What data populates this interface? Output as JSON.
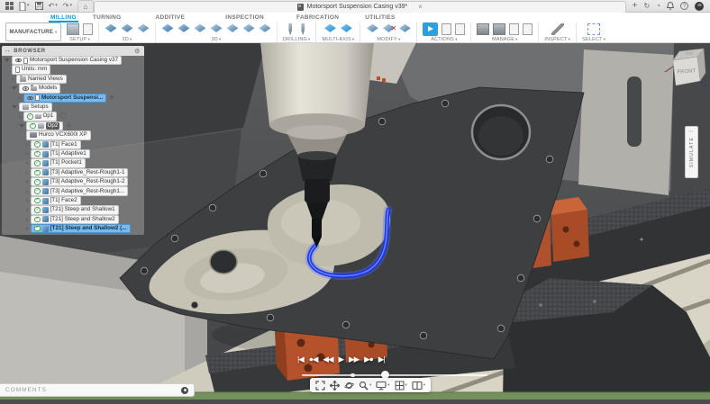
{
  "app": {
    "title": "Motorsport Suspension Casing v39*"
  },
  "titlebar": {
    "home_glyph": "⌂",
    "close_tab": "×",
    "new_tab": "+",
    "undo_glyph": "↶",
    "redo_glyph": "↷",
    "sync_glyph": "↻",
    "status_glyph": "◔",
    "help_glyph": "?"
  },
  "toolbar": {
    "workspace": "MANUFACTURE",
    "caret": "▾",
    "tabs": [
      {
        "label": "MILLING",
        "active": true
      },
      {
        "label": "TURNING"
      },
      {
        "label": "ADDITIVE"
      },
      {
        "label": "INSPECTION"
      },
      {
        "label": "FABRICATION"
      },
      {
        "label": "UTILITIES"
      }
    ],
    "groups": [
      {
        "label": "SETUP",
        "icons": [
          "new-setup",
          "nc-program"
        ]
      },
      {
        "label": "2D",
        "icons": [
          "2d-adaptive",
          "2d-pocket",
          "2d-contour"
        ]
      },
      {
        "label": "3D",
        "icons": [
          "adaptive-clearing",
          "pocket-clearing",
          "horizontal",
          "parallel",
          "scallop",
          "spiral",
          "morphed-spiral"
        ]
      },
      {
        "label": "DRILLING",
        "icons": [
          "drill",
          "circular"
        ]
      },
      {
        "label": "MULTI-AXIS",
        "icons": [
          "swarf",
          "multi-axis-contour"
        ]
      },
      {
        "label": "MODIFY",
        "icons": [
          "trim-toolpath",
          "delete-passes",
          "linking"
        ]
      },
      {
        "label": "ACTIONS",
        "icons": [
          "simulate",
          "post-process",
          "setup-sheet"
        ]
      },
      {
        "label": "MANAGE",
        "icons": [
          "tool-library",
          "machine-library",
          "generate-toolpath",
          "clear-toolpath"
        ]
      },
      {
        "label": "INSPECT",
        "icons": [
          "measure"
        ]
      },
      {
        "label": "SELECT",
        "icons": [
          "window-select"
        ]
      }
    ]
  },
  "browser": {
    "header": "BROWSER",
    "dots_glyph": "▪▪",
    "settings_glyph": "⚙",
    "tree": [
      {
        "depth": 0,
        "icons": [
          "tri-open",
          "eye",
          "doc"
        ],
        "label": "Motorsport Suspension Casing v37"
      },
      {
        "depth": 1,
        "icons": [
          "doc"
        ],
        "label": "Units: mm"
      },
      {
        "depth": 1,
        "icons": [
          "arrow",
          "folder"
        ],
        "label": "Named Views"
      },
      {
        "depth": 1,
        "icons": [
          "tri-open",
          "eye",
          "folder"
        ],
        "label": "Models"
      },
      {
        "depth": 2,
        "icons": [
          "arrow",
          "eye",
          "doc"
        ],
        "label": "Motorsport Suspensi...",
        "selected": true,
        "trailing": "⊗"
      },
      {
        "depth": 1,
        "icons": [
          "tri-open",
          "setup"
        ],
        "label": "Setups"
      },
      {
        "depth": 2,
        "icons": [
          "arrow",
          "check",
          "setup"
        ],
        "label": "Op1",
        "trailing": "◯"
      },
      {
        "depth": 2,
        "icons": [
          "tri-open",
          "check",
          "setup"
        ],
        "label": "Op2",
        "dark": true,
        "trailing": "◎"
      },
      {
        "depth": 3,
        "icons": [
          "machine"
        ],
        "label": "Hurco VCX600i XP"
      },
      {
        "depth": 3,
        "icons": [
          "arrow",
          "check",
          "op"
        ],
        "label": "[T1] Face1"
      },
      {
        "depth": 3,
        "icons": [
          "arrow",
          "check",
          "op"
        ],
        "label": "[T1] Adaptive1"
      },
      {
        "depth": 3,
        "icons": [
          "arrow",
          "check",
          "op"
        ],
        "label": "[T1] Pocket1"
      },
      {
        "depth": 3,
        "icons": [
          "arrow",
          "check",
          "op"
        ],
        "label": "[T3] Adaptive_Rest-Rough1-1"
      },
      {
        "depth": 3,
        "icons": [
          "arrow",
          "check",
          "op"
        ],
        "label": "[T3] Adaptive_Rest-Rough1-2"
      },
      {
        "depth": 3,
        "icons": [
          "arrow",
          "check",
          "op"
        ],
        "label": "[T3] Adaptive_Rest-Rough1..."
      },
      {
        "depth": 3,
        "icons": [
          "arrow",
          "check",
          "op"
        ],
        "label": "[T1] Face2"
      },
      {
        "depth": 3,
        "icons": [
          "arrow",
          "check",
          "op"
        ],
        "label": "[T21] Steep and Shallow1"
      },
      {
        "depth": 3,
        "icons": [
          "arrow",
          "check",
          "op"
        ],
        "label": "[T21] Steep and Shallow2"
      },
      {
        "depth": 3,
        "icons": [
          "arrow",
          "check",
          "op"
        ],
        "label": "[T21] Steep and Shallow2 (...",
        "selected": true
      }
    ]
  },
  "viewcube": {
    "front": "FRONT",
    "top": "TOP"
  },
  "simulate_panel": {
    "label": "SIMULATE",
    "dots": "▪▪"
  },
  "playback": {
    "buttons": [
      {
        "name": "go-to-start",
        "glyph": "|◀"
      },
      {
        "name": "previous-operation",
        "glyph": "●◀"
      },
      {
        "name": "step-back",
        "glyph": "◀◀"
      },
      {
        "name": "play",
        "glyph": "▶"
      },
      {
        "name": "step-forward",
        "glyph": "▶▶"
      },
      {
        "name": "next-operation",
        "glyph": "▶●"
      },
      {
        "name": "go-to-end",
        "glyph": "▶|"
      }
    ]
  },
  "comments": {
    "label": "COMMENTS"
  },
  "colors": {
    "accent_blue": "#0a9bd8",
    "selection_blue": "#7db9e8",
    "toolpath_blue": "#1634e8",
    "clamp_orange": "#b5522c",
    "table_beige": "#d9d5c6",
    "machine_gray": "#4b4c4e",
    "floor_green": "#73915d"
  }
}
